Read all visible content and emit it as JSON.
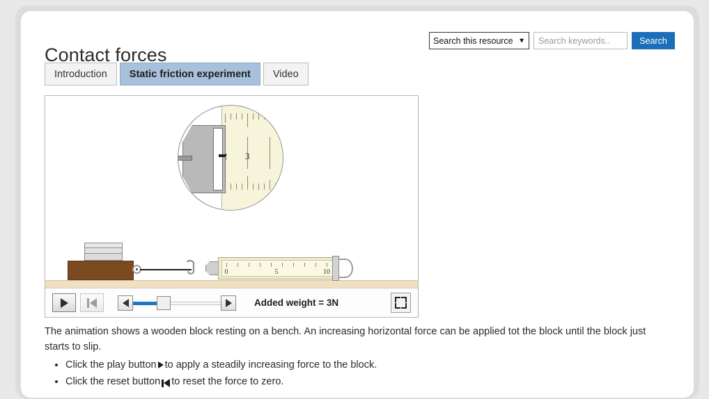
{
  "header": {
    "title": "Contact forces"
  },
  "search": {
    "scope_selected": "Search this resource",
    "scope_options": [
      "Search this resource"
    ],
    "placeholder": "Search keywords..",
    "value": "",
    "button_label": "Search",
    "button_color": "#1b6fba",
    "chevron_icon": "chevron-down-icon"
  },
  "tabs": [
    {
      "label": "Introduction",
      "active": false
    },
    {
      "label": "Static friction experiment",
      "active": true
    },
    {
      "label": "Video",
      "active": false
    }
  ],
  "simulation": {
    "magnifier": {
      "reading_numbers": [
        "2",
        "3"
      ],
      "needle_position": "just past 2"
    },
    "newton_meter": {
      "scale_labels": [
        "0",
        "5",
        "10"
      ],
      "scale_color": "#faf8e2"
    },
    "block": {
      "material_color": "#7b4a20",
      "weights_count": 3
    },
    "bench_color": "#f0dfc0"
  },
  "controls": {
    "play_label": "play-button",
    "play_icon": "play-icon",
    "play_enabled": true,
    "reset_label": "reset-button",
    "reset_icon": "skip-back-icon",
    "reset_enabled": false,
    "slider_left_icon": "triangle-left-icon",
    "slider_right_icon": "triangle-right-icon",
    "slider_fill_percent": 31,
    "slider_fill_color": "#1f77c4",
    "weight_label": "Added weight = 3N",
    "fullscreen_icon": "fullscreen-icon"
  },
  "body": {
    "paragraph": "The animation shows a wooden block resting on a bench. An increasing horizontal force can be applied tot the block until the block just starts to slip.",
    "bullets": [
      {
        "before": "Click the play button",
        "icon": "play-icon",
        "after": "to apply a steadily increasing force to the block."
      },
      {
        "before": "Click the reset button",
        "icon": "skip-back-icon",
        "after": "to reset the force to zero."
      }
    ]
  }
}
